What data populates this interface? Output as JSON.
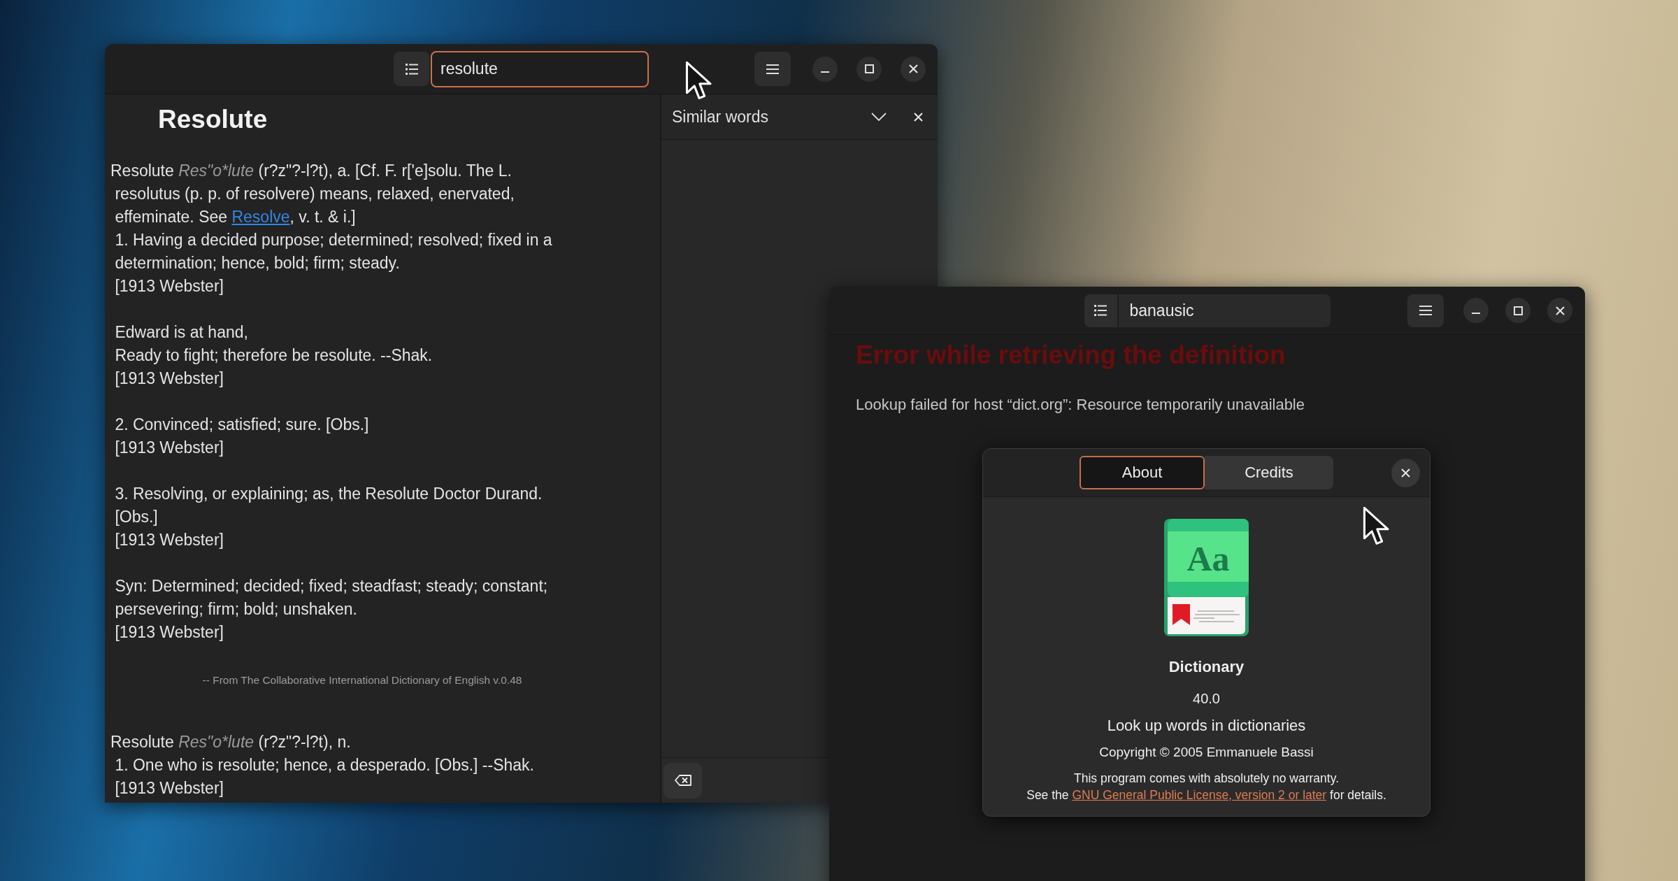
{
  "main_window": {
    "search": {
      "value": "resolute",
      "focused": true
    },
    "definition": {
      "title": "Resolute",
      "sections": [
        {
          "kind": "entry",
          "paragraphs": [
            [
              {
                "kind": "text",
                "text": "Resolute "
              },
              {
                "kind": "pronunciation",
                "text": "Res\"o*lute"
              },
              {
                "kind": "text",
                "text": " (r?z\"?-l?t), a. [Cf. F. r['e]solu. The L.\n resolutus (p. p. of resolvere) means, relaxed, enervated,\n effeminate. See "
              },
              {
                "kind": "link",
                "text": "Resolve"
              },
              {
                "kind": "text",
                "text": ", v. t. & i.]\n 1. Having a decided purpose; determined; resolved; fixed in a\n determination; hence, bold; firm; steady.\n [1913 Webster]"
              }
            ],
            [
              {
                "kind": "text",
                "text": " Edward is at hand,\n Ready to fight; therefore be resolute. --Shak.\n [1913 Webster]"
              }
            ],
            [
              {
                "kind": "text",
                "text": " 2. Convinced; satisfied; sure. [Obs.]\n [1913 Webster]"
              }
            ],
            [
              {
                "kind": "text",
                "text": " 3. Resolving, or explaining; as, the Resolute Doctor Durand.\n [Obs.]\n [1913 Webster]"
              }
            ],
            [
              {
                "kind": "text",
                "text": " Syn: Determined; decided; fixed; steadfast; steady; constant;\n persevering; firm; bold; unshaken.\n [1913 Webster]"
              }
            ]
          ]
        },
        {
          "kind": "source",
          "text": "-- From The Collaborative International Dictionary of English v.0.48"
        },
        {
          "kind": "entry",
          "paragraphs": [
            [
              {
                "kind": "text",
                "text": "Resolute "
              },
              {
                "kind": "pronunciation",
                "text": "Res\"o*lute"
              },
              {
                "kind": "text",
                "text": " (r?z\"?-l?t), n.\n 1. One who is resolute; hence, a desperado. [Obs.] --Shak.\n [1913 Webster]"
              }
            ]
          ]
        }
      ]
    },
    "sidebar": {
      "title": "Similar words"
    }
  },
  "error_window": {
    "search": {
      "value": "banausic",
      "focused": false
    },
    "error_title": "Error while retrieving the definition",
    "error_message": "Lookup failed for host “dict.org”: Resource temporarily unavailable"
  },
  "about_dialog": {
    "tabs": [
      {
        "label": "About",
        "selected": true
      },
      {
        "label": "Credits",
        "selected": false
      }
    ],
    "app_icon": {
      "letters": "Aa"
    },
    "app_name": "Dictionary",
    "version": "40.0",
    "description": "Look up words in dictionaries",
    "copyright": "Copyright © 2005 Emmanuele Bassi",
    "license": [
      {
        "kind": "text",
        "text": "This program comes with absolutely no warranty.\nSee the "
      },
      {
        "kind": "link",
        "text": "GNU General Public License, version 2 or later"
      },
      {
        "kind": "text",
        "text": " for details."
      }
    ]
  }
}
